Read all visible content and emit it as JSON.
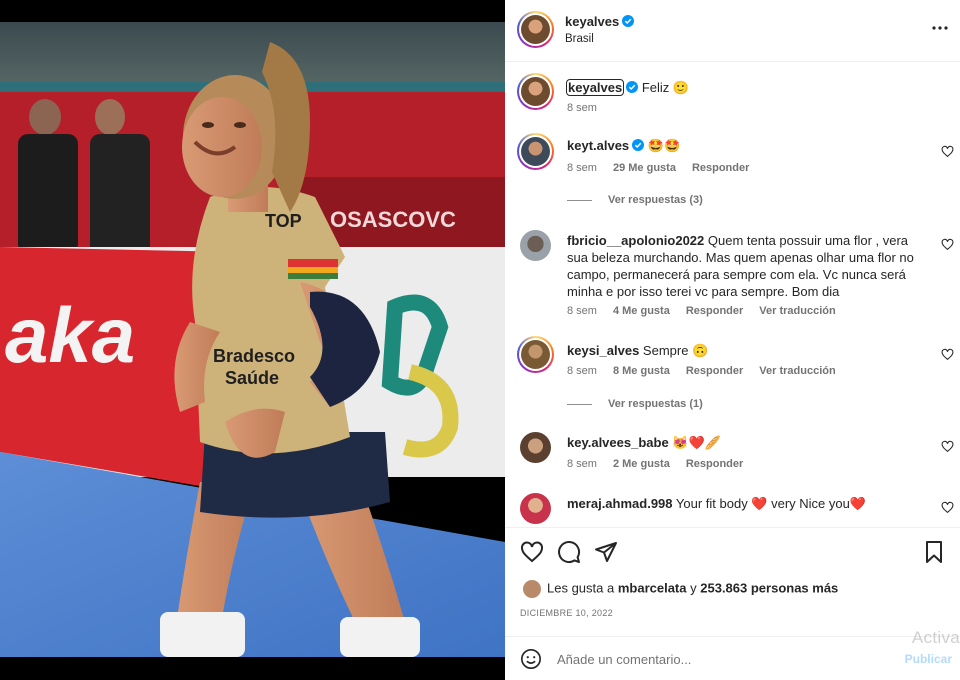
{
  "post": {
    "username": "keyalves",
    "location": "Brasil",
    "verified": true
  },
  "caption": {
    "username": "keyalves",
    "text": "Feliz 🙂",
    "time": "8 sem"
  },
  "comments": [
    {
      "username": "keyt.alves",
      "verified": true,
      "text": "🤩🤩",
      "time": "8 sem",
      "likes": "29 Me gusta",
      "reply": "Responder",
      "translate": "",
      "view_replies": "Ver respuestas (3)"
    },
    {
      "username": "fbricio__apolonio2022",
      "verified": false,
      "text": "Quem tenta possuir uma flor , vera sua beleza murchando. Mas quem apenas olhar uma flor no campo, permanecerá para sempre com ela. Vc nunca será minha e por isso terei vc para sempre. Bom dia",
      "time": "8 sem",
      "likes": "4 Me gusta",
      "reply": "Responder",
      "translate": "Ver traducción",
      "view_replies": ""
    },
    {
      "username": "keysi_alves",
      "verified": false,
      "text": "Sempre 🙃",
      "time": "8 sem",
      "likes": "8 Me gusta",
      "reply": "Responder",
      "translate": "Ver traducción",
      "view_replies": "Ver respuestas (1)"
    },
    {
      "username": "key.alvees_babe",
      "verified": false,
      "text": "😻❤️🥖",
      "time": "8 sem",
      "likes": "2 Me gusta",
      "reply": "Responder",
      "translate": "",
      "view_replies": ""
    },
    {
      "username": "meraj.ahmad.998",
      "verified": false,
      "text": "Your fit body ❤️ very Nice you❤️",
      "time": "",
      "likes": "",
      "reply": "",
      "translate": "",
      "view_replies": ""
    }
  ],
  "likes_bar": {
    "prefix": "Les gusta a",
    "first_user": "mbarcelata",
    "connector": "y",
    "others": "253.863 personas más"
  },
  "date": "DICIEMBRE 10, 2022",
  "add_comment": {
    "placeholder": "Añade un comentario...",
    "publish": "Publicar"
  },
  "watermark": {
    "line1": "Activa"
  },
  "photo": {
    "banner_text_left": "aka",
    "banner_text_right": "OSASCOVC",
    "jersey_text": "TOP",
    "jersey_sponsor": "Bradesco Saúde"
  },
  "colors": {
    "verified_blue": "#0095f6",
    "heart_red": "#ed4956",
    "link_blue": "#0095f6"
  }
}
